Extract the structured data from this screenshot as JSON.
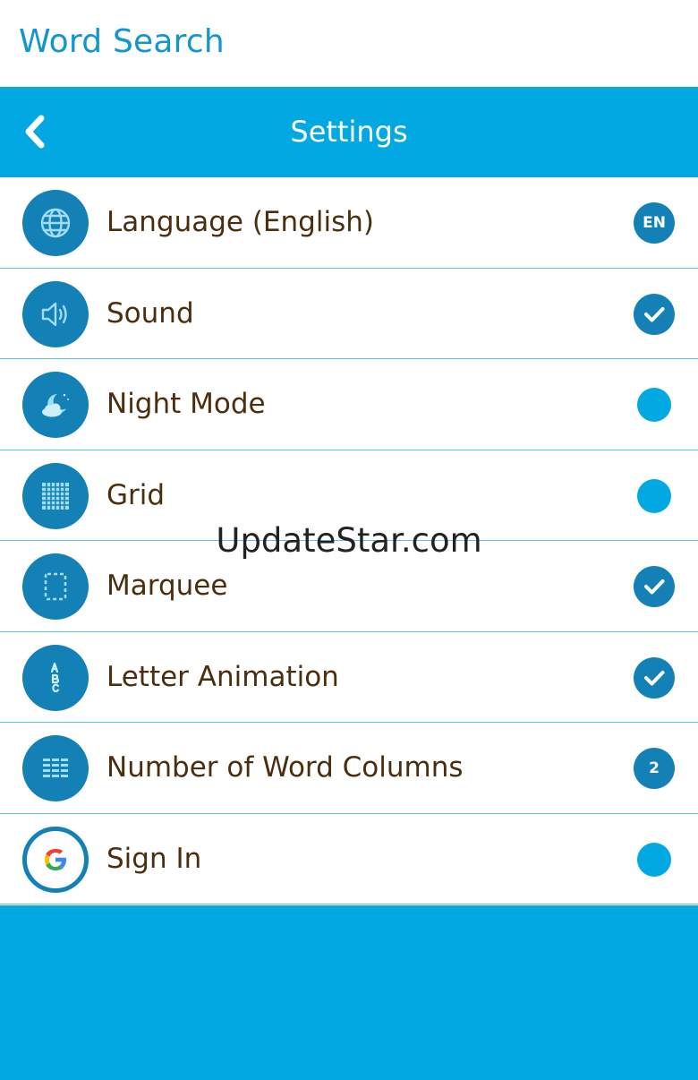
{
  "app": {
    "title": "Word Search"
  },
  "header": {
    "title": "Settings"
  },
  "settings": [
    {
      "label": "Language (English)",
      "icon": "globe-icon",
      "indicator": "text",
      "indicator_text": "EN"
    },
    {
      "label": "Sound",
      "icon": "speaker-icon",
      "indicator": "check",
      "enabled": true
    },
    {
      "label": "Night Mode",
      "icon": "moon-cloud-icon",
      "indicator": "dot",
      "enabled": false
    },
    {
      "label": "Grid",
      "icon": "grid-icon",
      "indicator": "dot",
      "enabled": false
    },
    {
      "label": "Marquee",
      "icon": "marquee-icon",
      "indicator": "check",
      "enabled": true
    },
    {
      "label": "Letter Animation",
      "icon": "abc-icon",
      "indicator": "check",
      "enabled": true
    },
    {
      "label": "Number of Word Columns",
      "icon": "columns-icon",
      "indicator": "text",
      "indicator_text": "2"
    },
    {
      "label": "Sign In",
      "icon": "google-icon",
      "indicator": "dot",
      "enabled": false
    }
  ],
  "watermark": "UpdateStar.com",
  "colors": {
    "primary": "#02a8e2",
    "icon_bg": "#1481b6",
    "label_text": "#4a2e0e",
    "title_text": "#1296cf"
  }
}
